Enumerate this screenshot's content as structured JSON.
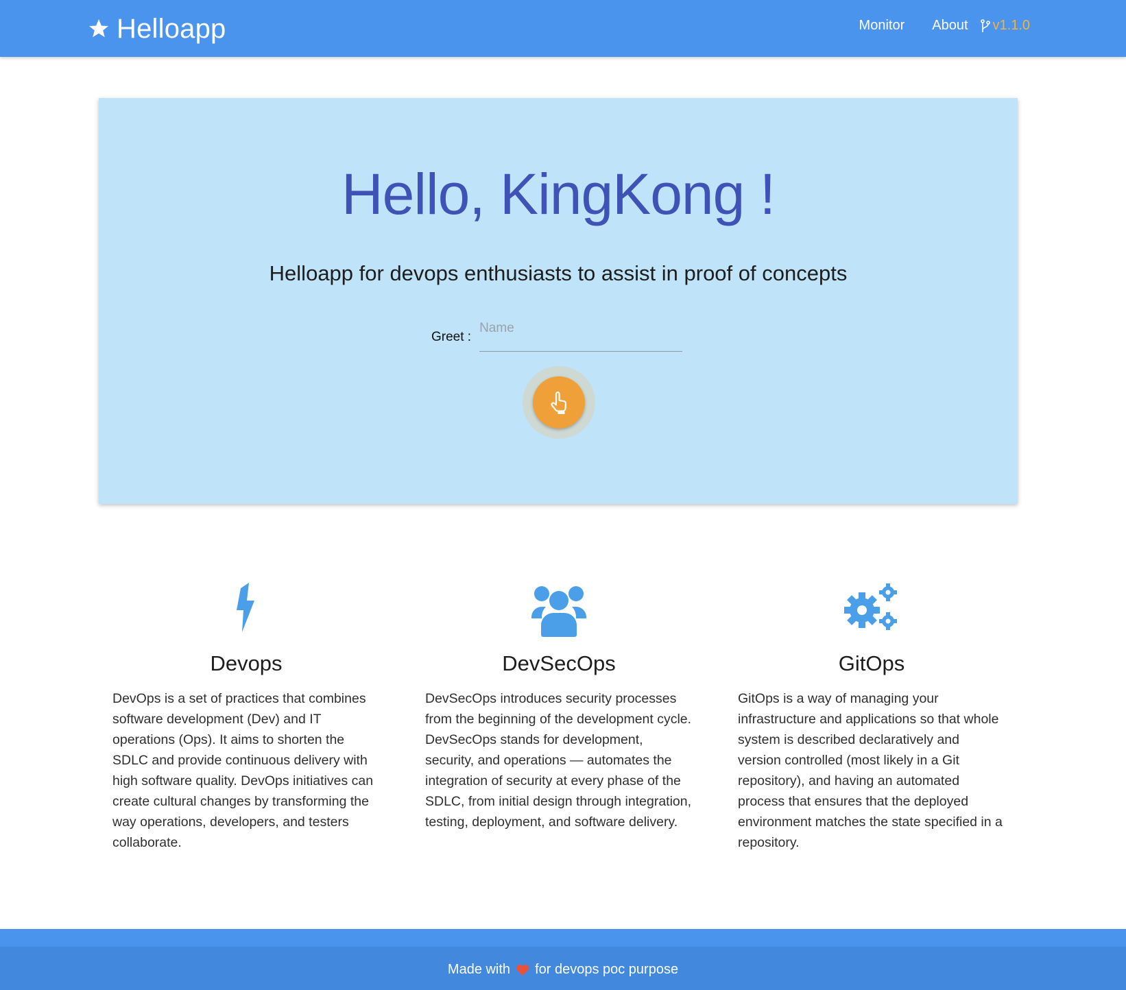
{
  "navbar": {
    "brand": "Helloapp",
    "brand_icon": "star-icon",
    "links": [
      "Monitor",
      "About"
    ],
    "version": "v1.1.0",
    "version_icon": "git-branch-icon",
    "version_color": "#f3b33c"
  },
  "hero": {
    "title": "Hello, KingKong !",
    "subtitle": "Helloapp for devops enthusiasts to assist in proof of concepts",
    "greet_label": "Greet :",
    "input_placeholder": "Name",
    "input_value": "",
    "button_icon": "pointing-hand-icon",
    "title_color": "#3f52b5",
    "background": "#bfe3f8",
    "button_color": "#f0a039"
  },
  "features": [
    {
      "icon": "lightning-bolt-icon",
      "title": "Devops",
      "text": "DevOps is a set of practices that combines software development (Dev) and IT operations (Ops). It aims to shorten the SDLC and provide continuous delivery with high software quality. DevOps initiatives can create cultural changes by transforming the way operations, developers, and testers collaborate."
    },
    {
      "icon": "users-icon",
      "title": "DevSecOps",
      "text": "DevSecOps introduces security processes from the beginning of the development cycle. DevSecOps stands for development, security, and operations — automates the integration of security at every phase of the SDLC, from initial design through integration, testing, deployment, and software delivery."
    },
    {
      "icon": "gears-icon",
      "title": "GitOps",
      "text": "GitOps is a way of managing your infrastructure and applications so that whole system is described declaratively and version controlled (most likely in a Git repository), and having an automated process that ensures that the deployed environment matches the state specified in a repository."
    }
  ],
  "footer": {
    "prefix": "Made with",
    "heart_icon": "heart-icon",
    "suffix": "for devops poc purpose"
  },
  "colors": {
    "accent": "#4a94ee",
    "icon_blue": "#4a9fe8",
    "heart": "#e8523a"
  }
}
